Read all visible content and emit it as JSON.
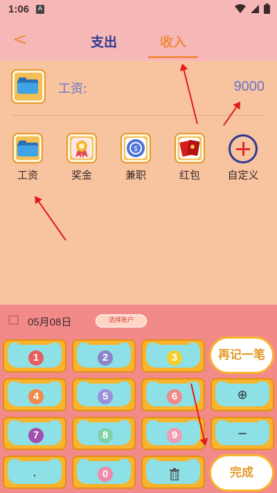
{
  "status": {
    "time": "1:06",
    "app_badge": "A"
  },
  "header": {
    "tab_expense": "支出",
    "tab_income": "收入"
  },
  "entry": {
    "label": "工资:",
    "amount": "9000"
  },
  "categories": [
    {
      "label": "工资"
    },
    {
      "label": "奖金"
    },
    {
      "label": "兼职"
    },
    {
      "label": "红包"
    },
    {
      "label": "自定义"
    }
  ],
  "datebar": {
    "date": "05月08日",
    "account_button": "选择账户"
  },
  "keypad": {
    "keys": [
      "1",
      "2",
      "3",
      "4",
      "5",
      "6",
      "7",
      "8",
      "9",
      ".",
      "0"
    ],
    "plus": "⊕",
    "minus": "−",
    "again": "再记一笔",
    "done": "完成"
  },
  "colors": {
    "accent": "#f08a42",
    "title": "#2e3890",
    "keypad_bg": "#f38a8a"
  }
}
